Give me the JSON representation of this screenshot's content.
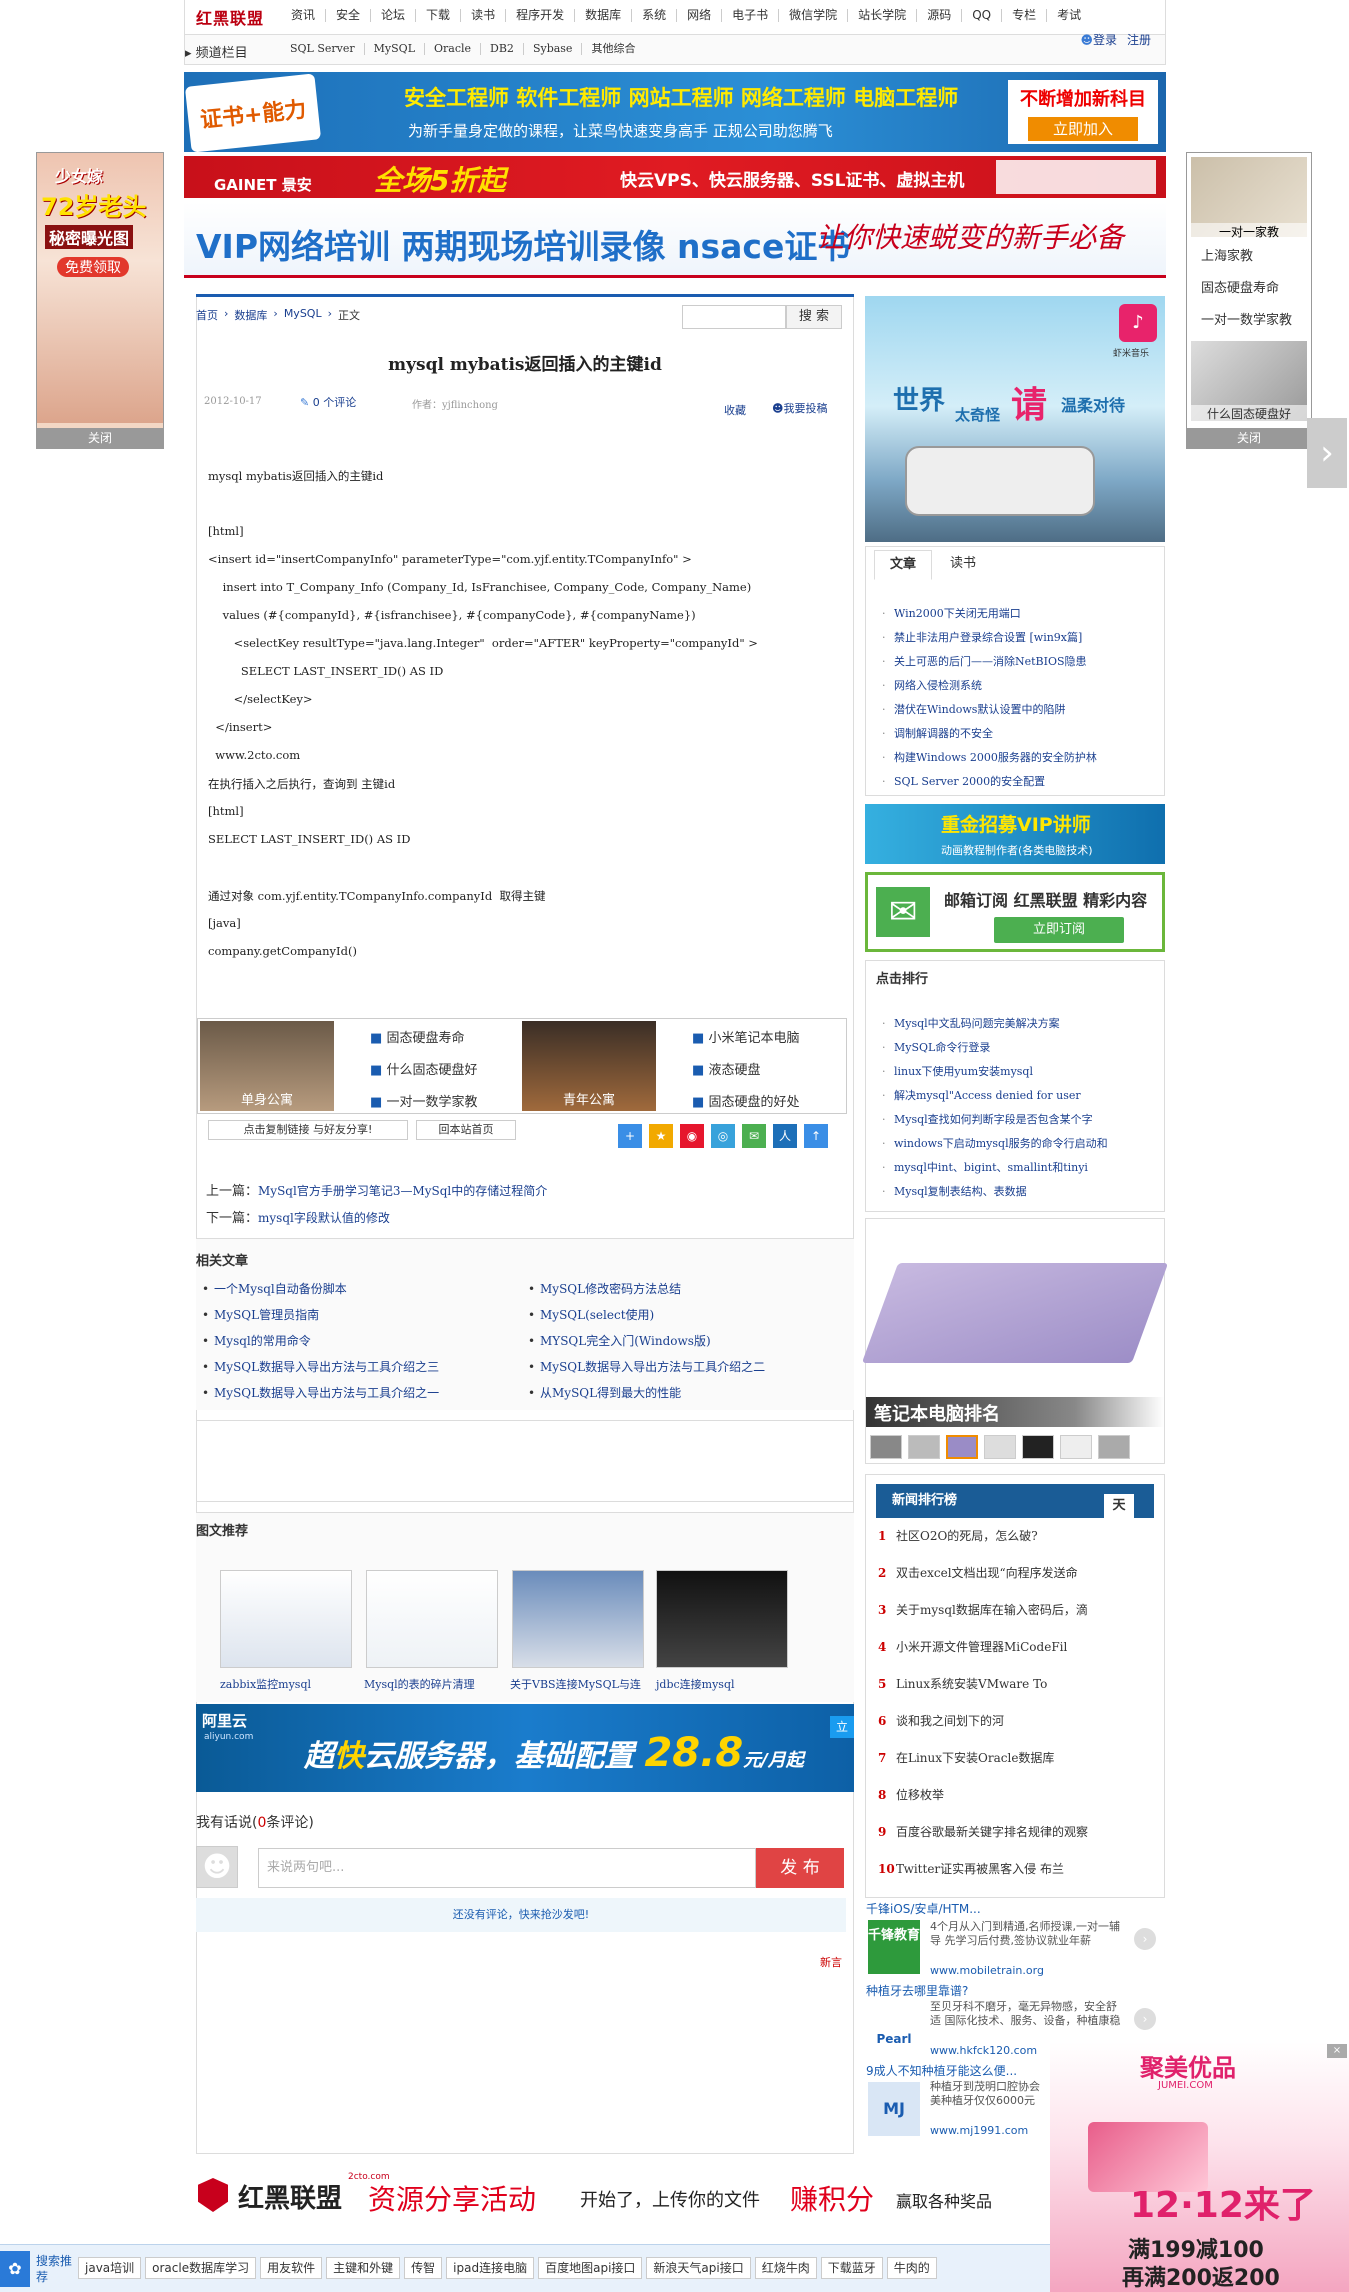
{
  "topnav": {
    "logo": "红黑联盟",
    "items": [
      "资讯",
      "安全",
      "论坛",
      "下载",
      "读书",
      "程序开发",
      "数据库",
      "系统",
      "网络",
      "电子书",
      "微信学院",
      "站长学院",
      "源码",
      "QQ",
      "专栏",
      "考试"
    ],
    "login": "登录",
    "register": "注册"
  },
  "subnav": {
    "label": "频道栏目",
    "items": [
      "SQL Server",
      "MySQL",
      "Oracle",
      "DB2",
      "Sybase",
      "其他综合"
    ]
  },
  "banners": {
    "cert_title": "安全工程师 软件工程师 网站工程师 网络工程师 电脑工程师",
    "cert_sub": "为新手量身定做的课程，让菜鸟快速变身高手 正规公司助您腾飞",
    "cert_badge": "证书+能力",
    "cert_right": "不断增加新科目",
    "cert_btn": "立即加入",
    "gainet_logo": "GAINET 景安",
    "gainet_sale": "全场5折起",
    "gainet_text": "快云VPS、快云服务器、SSL证书、虚拟主机",
    "vip_text": "VIP网络培训  两期现场培训录像  nsace证书",
    "vip_script": "让你快速蜕变的新手必备"
  },
  "float_left": {
    "line1": "少女嫁",
    "line2": "72岁老头",
    "line3": "秘密曝光图",
    "btn": "免费领取",
    "close": "关闭"
  },
  "float_right": {
    "items": [
      "一对一家教",
      "上海家教",
      "固态硬盘寿命",
      "一对一数学家教",
      "什么固态硬盘好"
    ],
    "close": "关闭"
  },
  "article": {
    "breadcrumb": [
      "首页",
      "数据库",
      "MySQL",
      "正文"
    ],
    "search_btn": "搜 索",
    "title": "mysql mybatis返回插入的主键id",
    "date": "2012-10-17",
    "comments": "0 个评论",
    "author": "作者：yjflinchong",
    "fav": "收藏",
    "submit": "我要投稿",
    "body": [
      "mysql mybatis返回插入的主键id",
      "",
      "[html]",
      "<insert id=\"insertCompanyInfo\" parameterType=\"com.yjf.entity.TCompanyInfo\" >",
      "    insert into T_Company_Info (Company_Id, IsFranchisee, Company_Code, Company_Name)",
      "    values (#{companyId}, #{isfranchisee}, #{companyCode}, #{companyName})",
      "       <selectKey resultType=\"java.lang.Integer\"  order=\"AFTER\" keyProperty=\"companyId\" >",
      "         SELECT LAST_INSERT_ID() AS ID",
      "       </selectKey>",
      "  </insert>",
      "  www.2cto.com",
      "在执行插入之后执行，查询到 主键id",
      "[html]",
      "SELECT LAST_INSERT_ID() AS ID",
      "",
      "通过对象 com.yjf.entity.TCompanyInfo.companyId  取得主键",
      "[java]",
      "company.getCompanyId()"
    ]
  },
  "ad_strip": {
    "img1": "单身公寓",
    "links1": [
      "固态硬盘寿命",
      "什么固态硬盘好",
      "一对一数学家教"
    ],
    "img2": "青年公寓",
    "links2": [
      "小米笔记本电脑",
      "液态硬盘",
      "固态硬盘的好处"
    ]
  },
  "share": {
    "copy_btn": "点击复制链接 与好友分享!",
    "home_btn": "回本站首页"
  },
  "prevnext": {
    "prev_label": "上一篇：",
    "prev": "MySql官方手册学习笔记3—MySql中的存储过程简介",
    "next_label": "下一篇：",
    "next": "mysql字段默认值的修改"
  },
  "related": {
    "title": "相关文章",
    "left": [
      "一个Mysql自动备份脚本",
      "MySQL管理员指南",
      "Mysql的常用命令",
      "MySQL数据导入导出方法与工具介绍之三",
      "MySQL数据导入导出方法与工具介绍之一"
    ],
    "right": [
      "MySQL修改密码方法总结",
      "MySQL(select使用)",
      "MYSQL完全入门(Windows版)",
      "MySQL数据导入导出方法与工具介绍之二",
      "从MySQL得到最大的性能"
    ]
  },
  "pic_rec": {
    "title": "图文推荐",
    "items": [
      "zabbix监控mysql",
      "Mysql的表的碎片清理",
      "关于VBS连接MySQL与连",
      "jdbc连接mysql"
    ]
  },
  "aliyun": {
    "logo": "阿里云",
    "domain": "aliyun.com",
    "text_pre": "超",
    "text_em": "快",
    "text_post": "云服务器，基础配置",
    "price": "28.8",
    "unit": "元/月起",
    "corner": "立"
  },
  "comment": {
    "title_pre": "我有话说(",
    "count": "0",
    "title_post": "条评论)",
    "placeholder": "来说两句吧...",
    "btn": "发 布",
    "empty": "还没有评论，快来抢沙发吧!",
    "newest": "新言"
  },
  "bottom_banner": {
    "logo": "红黑联盟",
    "domain": "2cto.com",
    "t1": "资源分享活动",
    "t2": "开始了，上传你的文件",
    "t3": "赚积分",
    "t4": "赢取各种奖品"
  },
  "bottom_bar": {
    "label": "搜索推荐",
    "items": [
      "java培训",
      "oracle数据库学习",
      "用友软件",
      "主键和外键",
      "传智",
      "ipad连接电脑",
      "百度地图api接口",
      "新浪天气api接口",
      "红烧牛肉",
      "下载蓝牙",
      "牛肉的"
    ]
  },
  "corner_ad": {
    "brand": "聚美优品",
    "domain": "JUMEI.COM",
    "date": "12·12来了",
    "o1": "满199减100",
    "o2": "再满200返200"
  },
  "sidebar": {
    "pic_ad": {
      "brand": "虾米音乐",
      "t1": "世界",
      "t2": "太奇怪",
      "t3": "请",
      "t4": "温柔对待"
    },
    "tabs": [
      "文章",
      "读书"
    ],
    "articles": [
      "Win2000下关闭无用端口",
      "禁止非法用户登录综合设置 [win9x篇]",
      "关上可恶的后门——消除NetBIOS隐患",
      "网络入侵检测系统",
      "潜伏在Windows默认设置中的陷阱",
      "调制解调器的不安全",
      "构建Windows 2000服务器的安全防护林",
      "SQL Server 2000的安全配置"
    ],
    "vip_ad_t1": "重金招募VIP讲师",
    "vip_ad_t2": "动画教程制作者(各类电脑技术)",
    "mail_ad_t1": "邮箱订阅 红黑联盟 精彩内容",
    "mail_ad_btn": "立即订阅",
    "hot_title": "点击排行",
    "hot": [
      "Mysql中文乱码问题完美解决方案",
      "MySQL命令行登录",
      "linux下使用yum安装mysql",
      "解决mysql\"Access denied for user",
      "Mysql查找如何判断字段是否包含某个字",
      "windows下启动mysql服务的命令行启动和",
      "mysql中int、bigint、smallint和tinyi",
      "Mysql复制表结构、表数据"
    ],
    "laptop_title": "笔记本电脑排名",
    "news_title": "新闻排行榜",
    "news_tab": "天",
    "news": [
      "社区O2O的死局，怎么破?",
      "双击excel文档出现“向程序发送命",
      "关于mysql数据库在输入密码后，滴",
      "小米开源文件管理器MiCodeFil",
      "Linux系统安装VMware To",
      "谈和我之间划下的河",
      "在Linux下安装Oracle数据库",
      "位移枚举",
      "百度谷歌最新关键字排名规律的观察",
      "Twitter证实再被黑客入侵 布兰"
    ]
  },
  "side_text_ads": [
    {
      "title": "千锋iOS/安卓/HTM...",
      "logo": "千锋教育",
      "desc": "4个月从入门到精通,名师授课,一对一辅导 先学习后付费,签协议就业年薪",
      "url": "www.mobiletrain.org"
    },
    {
      "title": "种植牙去哪里靠谱?",
      "logo": "Pearl",
      "desc": "至贝牙科不磨牙，毫无异物感，安全舒适 国际化技术、服务、设备，种植康稳",
      "url": "www.hkfck120.com"
    },
    {
      "title": "9成人不知种植牙能这么便...",
      "logo": "MJ",
      "desc": "种植牙到茂明口腔协会 美种植牙仅仅6000元",
      "url": "www.mj1991.com"
    }
  ],
  "colors": {
    "accent_red": "#cc0000",
    "link_blue": "#1a3f8f",
    "nav_border": "#dddddd"
  }
}
